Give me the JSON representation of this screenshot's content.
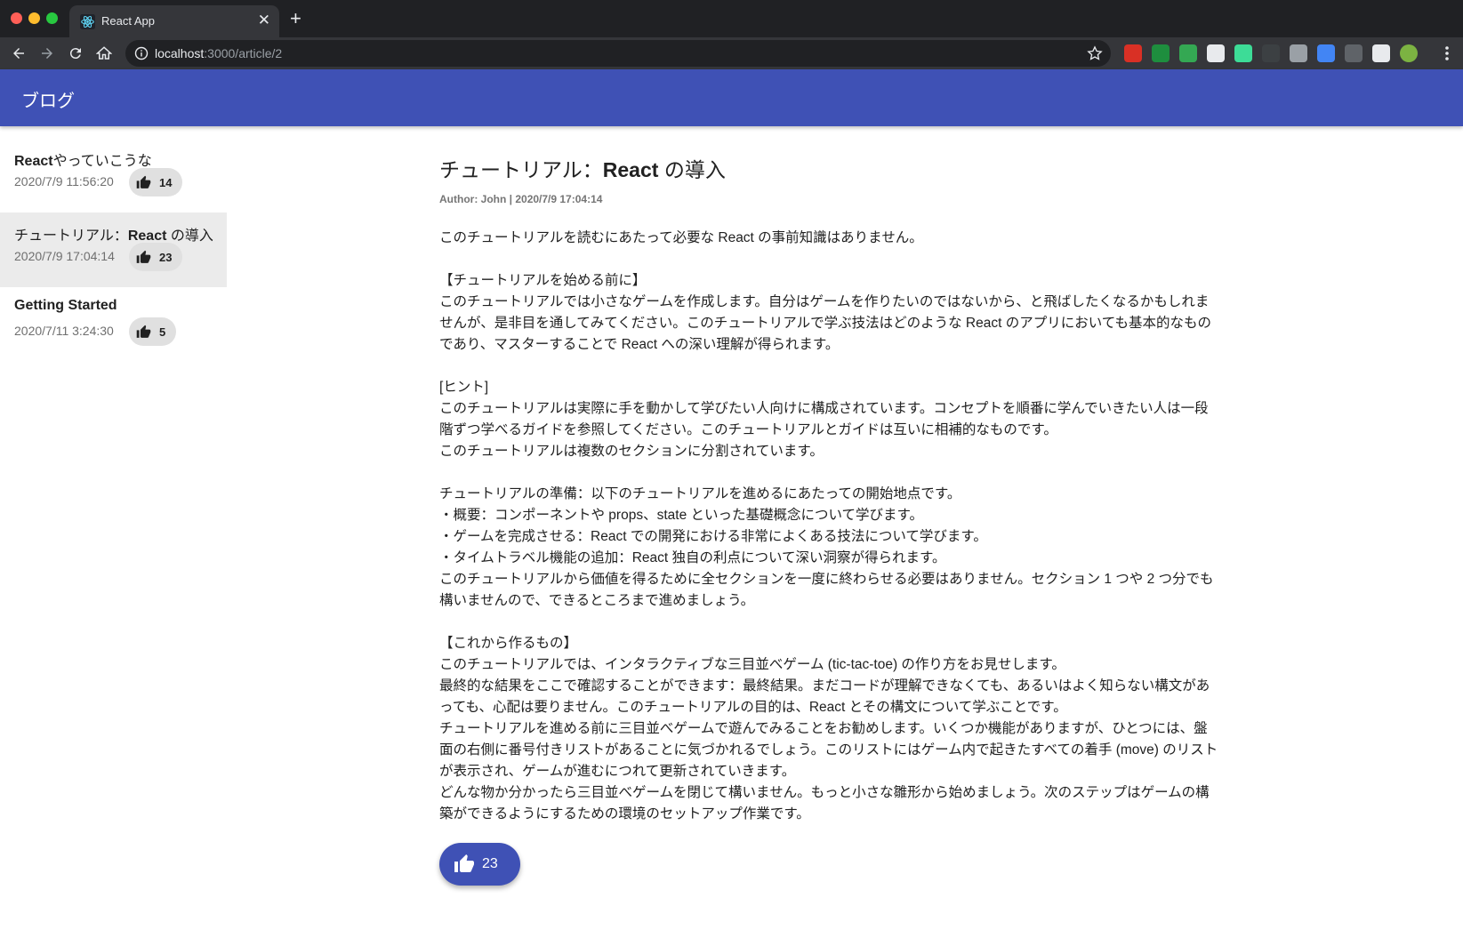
{
  "browser": {
    "tab_title": "React App",
    "url_host": "localhost",
    "url_path": ":3000/article/2",
    "extensions": [
      {
        "icon": "ext-red-icon",
        "color": "#d93025"
      },
      {
        "icon": "ext-green-circle-icon",
        "color": "#1e8e3e"
      },
      {
        "icon": "ext-target-icon",
        "color": "#34a853"
      },
      {
        "icon": "ext-grammar-icon",
        "color": "#e8eaed"
      },
      {
        "icon": "ext-n-icon",
        "color": "#3ddc97"
      },
      {
        "icon": "ext-dark-circle-icon",
        "color": "#3c4043"
      },
      {
        "icon": "ext-vue-icon",
        "color": "#9aa0a6"
      },
      {
        "icon": "ext-blue-icon",
        "color": "#4285f4"
      },
      {
        "icon": "ext-cube-icon",
        "color": "#5f6368"
      },
      {
        "icon": "puzzle-icon",
        "color": "#e8eaed"
      },
      {
        "icon": "profile-avatar-icon",
        "color": "#7cb342"
      }
    ]
  },
  "appbar": {
    "title": "ブログ",
    "color": "#3f51b5"
  },
  "sidebar": {
    "items": [
      {
        "title_bold": "React",
        "title_rest": "やっていこうな",
        "date": "2020/7/9 11:56:20",
        "likes": "14",
        "selected": false
      },
      {
        "title_bold": "",
        "title_pre": "チュートリアル：",
        "title_mid": "React",
        "title_rest": " の導入",
        "date": "2020/7/9 17:04:14",
        "likes": "23",
        "selected": true
      },
      {
        "title_bold": "Getting Started",
        "title_rest": "",
        "date": "2020/7/11 3:24:30",
        "likes": "5",
        "selected": false
      }
    ]
  },
  "article": {
    "title_pre": "チュートリアル：",
    "title_bold": "React",
    "title_post": " の導入",
    "meta": "Author: John | 2020/7/9 17:04:14",
    "lines": [
      "このチュートリアルを読むにあたって必要な React の事前知識はありません。",
      "",
      "【チュートリアルを始める前に】",
      "このチュートリアルでは小さなゲームを作成します。自分はゲームを作りたいのではないから、と飛ばしたくなるかもしれま",
      "せんが、是非目を通してみてください。このチュートリアルで学ぶ技法はどのような React のアプリにおいても基本的なもの",
      "であり、マスターすることで React への深い理解が得られます。",
      "",
      "[ヒント]",
      "このチュートリアルは実際に手を動かして学びたい人向けに構成されています。コンセプトを順番に学んでいきたい人は一段",
      "階ずつ学べるガイドを参照してください。このチュートリアルとガイドは互いに相補的なものです。",
      "このチュートリアルは複数のセクションに分割されています。",
      "",
      "チュートリアルの準備：以下のチュートリアルを進めるにあたっての開始地点です。",
      "・概要：コンポーネントや props、state といった基礎概念について学びます。",
      "・ゲームを完成させる：React での開発における非常によくある技法について学びます。",
      "・タイムトラベル機能の追加：React 独自の利点について深い洞察が得られます。",
      "このチュートリアルから価値を得るために全セクションを一度に終わらせる必要はありません。セクション 1 つや 2 つ分でも",
      "構いませんので、できるところまで進めましょう。",
      "",
      "【これから作るもの】",
      "このチュートリアルでは、インタラクティブな三目並べゲーム (tic-tac-toe) の作り方をお見せします。",
      "最終的な結果をここで確認することができます：最終結果。まだコードが理解できなくても、あるいはよく知らない構文があ",
      "っても、心配は要りません。このチュートリアルの目的は、React とその構文について学ぶことです。",
      "チュートリアルを進める前に三目並べゲームで遊んでみることをお勧めします。いくつか機能がありますが、ひとつには、盤",
      "面の右側に番号付きリストがあることに気づかれるでしょう。このリストにはゲーム内で起きたすべての着手 (move) のリスト",
      "が表示され、ゲームが進むにつれて更新されていきます。",
      "どんな物か分かったら三目並べゲームを閉じて構いません。もっと小さな雛形から始めましょう。次のステップはゲームの構",
      "築ができるようにするための環境のセットアップ作業です。"
    ],
    "like_count": "23"
  }
}
